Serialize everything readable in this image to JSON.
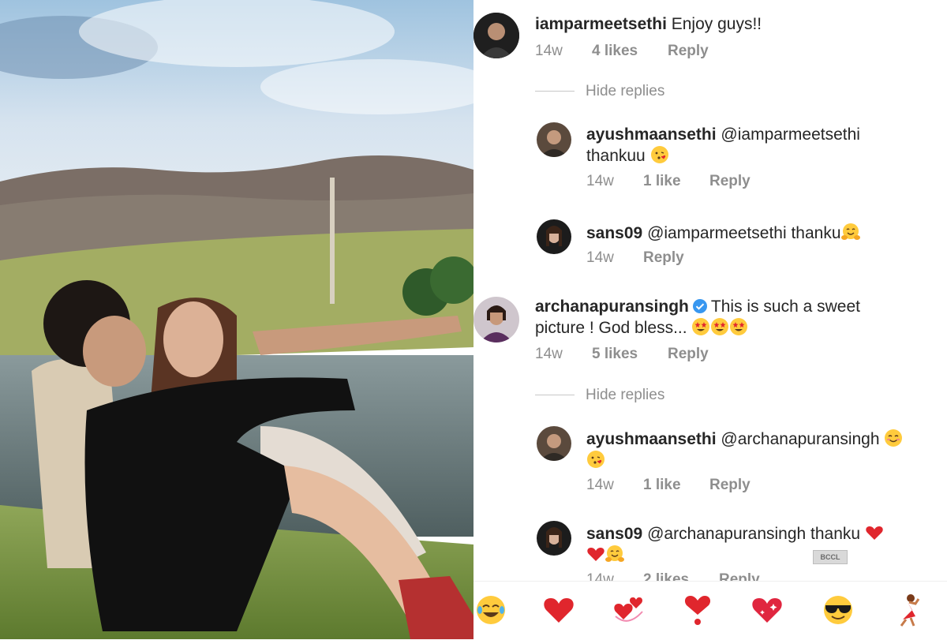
{
  "photo": {
    "alt": "couple sitting by a lake"
  },
  "comments": [
    {
      "username": "iamparmeetsethi",
      "text": "Enjoy guys!!",
      "time": "14w",
      "likes": "4 likes",
      "reply": "Reply",
      "hide_replies": "Hide replies"
    },
    {
      "username": "ayushmaansethi",
      "text_line1": "@iamparmeetsethi",
      "text_line2": "thankuu",
      "time": "14w",
      "likes": "1 like",
      "reply": "Reply"
    },
    {
      "username": "sans09",
      "text": "@iamparmeetsethi thanku",
      "time": "14w",
      "reply": "Reply"
    },
    {
      "username": "archanapuransingh",
      "text_line1": "This is such a sweet",
      "text_line2": "picture ! God bless...",
      "time": "14w",
      "likes": "5 likes",
      "reply": "Reply",
      "hide_replies": "Hide replies"
    },
    {
      "username": "ayushmaansethi",
      "text": "@archanapuransingh",
      "time": "14w",
      "likes": "1 like",
      "reply": "Reply"
    },
    {
      "username": "sans09",
      "text": "@archanapuransingh thanku",
      "time": "14w",
      "likes": "2 likes",
      "reply": "Reply"
    }
  ],
  "watermark": "BCCL",
  "emoji_bar": [
    "joy-emoji",
    "red-heart-emoji",
    "revolving-hearts-emoji",
    "heart-exclamation-emoji",
    "sparkling-heart-emoji",
    "sunglasses-emoji",
    "dancer-emoji"
  ],
  "colors": {
    "verified": "#3897f0",
    "meta_grey": "#8e8e8e",
    "heart": "#e0262d"
  }
}
